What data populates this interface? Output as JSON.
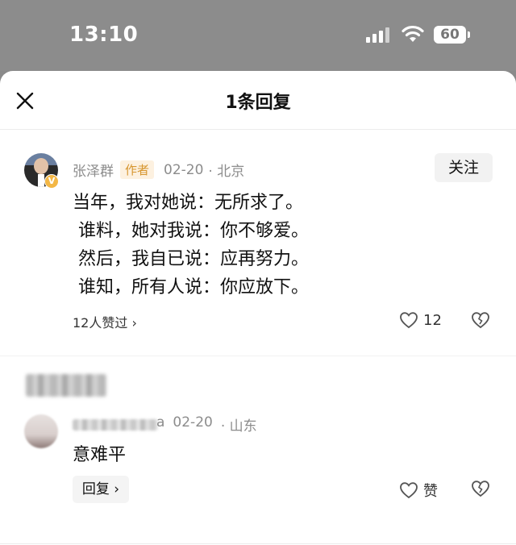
{
  "status": {
    "time": "13:10",
    "battery": "60"
  },
  "header": {
    "title": "1条回复"
  },
  "main_comment": {
    "author": "张泽群",
    "author_tag": "作者",
    "date": "02-20",
    "location": "· 北京",
    "follow_label": "关注",
    "lines": [
      "当年，我对她说：无所求了。",
      " 谁料，她对我说：你不够爱。",
      " 然后，我自已说：应再努力。",
      " 谁知，所有人说：你应放下。"
    ],
    "likers": "12人赞过 ›",
    "like_count": "12"
  },
  "reply": {
    "name_suffix": "a",
    "date": "02-20",
    "location": "· 山东",
    "text": "意难平",
    "like_label": "赞",
    "reply_button": "回复 ›"
  }
}
